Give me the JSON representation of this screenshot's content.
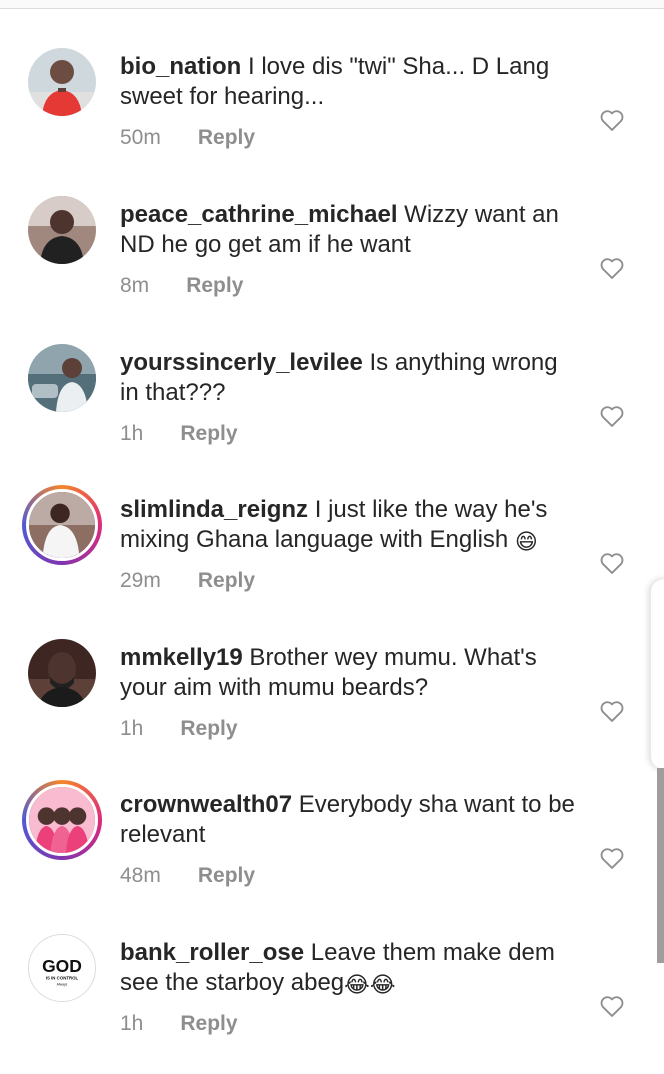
{
  "comments": [
    {
      "username": "bio_nation",
      "text": " I love dis \"twi\" Sha... D Lang sweet for hearing...",
      "time": "50m",
      "reply": "Reply",
      "story_ring": false
    },
    {
      "username": "peace_cathrine_michael",
      "text": " Wizzy want an ND he go get am if he want",
      "time": "8m",
      "reply": "Reply",
      "story_ring": false
    },
    {
      "username": "yourssincerly_levilee",
      "text": " Is anything wrong in that???",
      "time": "1h",
      "reply": "Reply",
      "story_ring": false
    },
    {
      "username": "slimlinda_reignz",
      "text": " I just like the way he's mixing Ghana language with English ",
      "emoji": "😄",
      "time": "29m",
      "reply": "Reply",
      "story_ring": true
    },
    {
      "username": "mmkelly19",
      "text": " Brother wey mumu. What's your aim with mumu beards?",
      "time": "1h",
      "reply": "Reply",
      "story_ring": false
    },
    {
      "username": "crownwealth07",
      "text": " Everybody sha want to be relevant",
      "time": "48m",
      "reply": "Reply",
      "story_ring": true
    },
    {
      "username": "bank_roller_ose",
      "text": " Leave them make dem see the starboy abeg",
      "emoji": "😂😂",
      "time": "1h",
      "reply": "Reply",
      "story_ring": false,
      "avatar_logo": {
        "main": "GOD",
        "sub": "IS IN CONTROL",
        "tiny": "Always"
      }
    }
  ],
  "icons": {
    "like": "heart-outline-icon"
  },
  "colors": {
    "text": "#262626",
    "muted": "#8e8e8e",
    "ring_start": "#f58529",
    "ring_end": "#8134af"
  }
}
